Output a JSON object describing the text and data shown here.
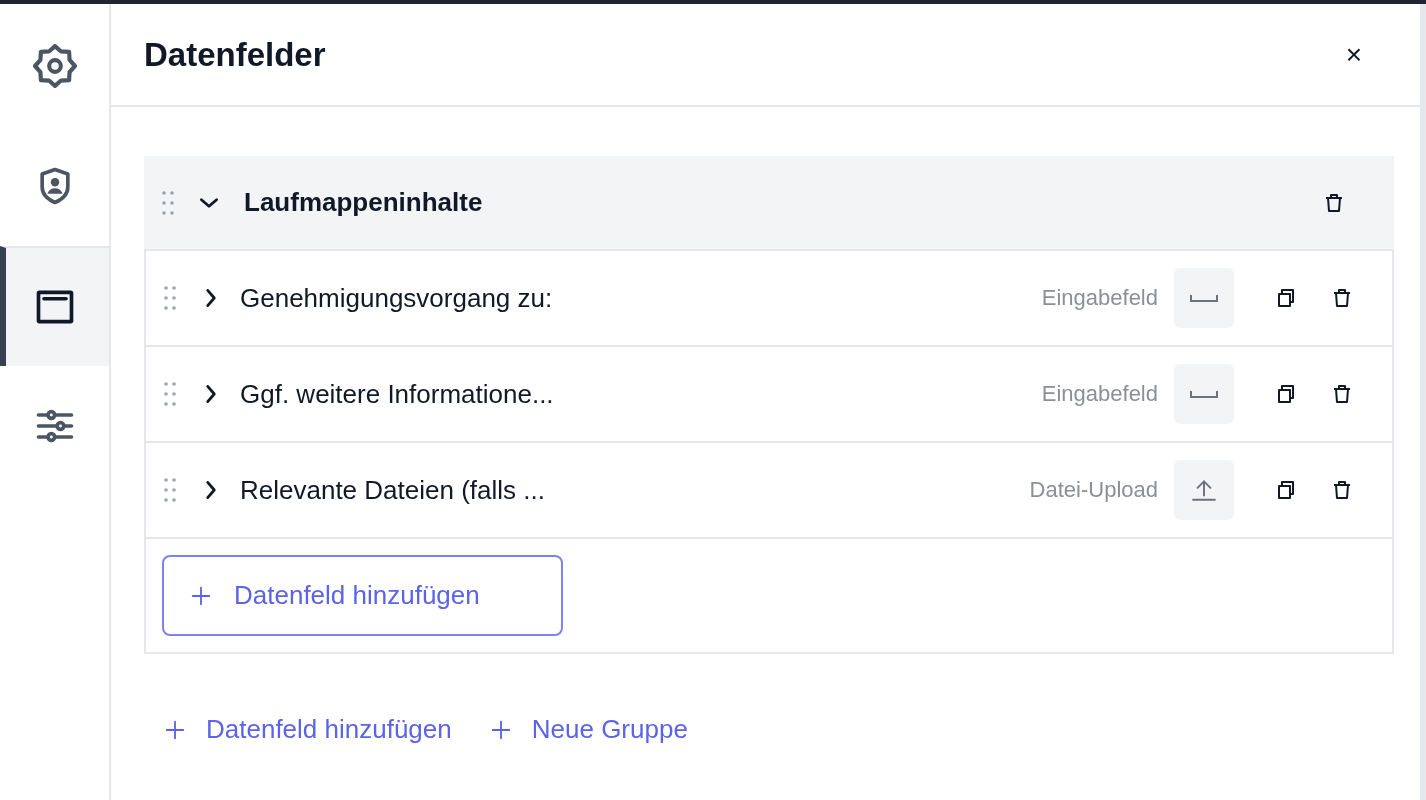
{
  "sidebar": {
    "items": [
      {
        "kind": "settings",
        "selected": false
      },
      {
        "kind": "shield",
        "selected": false
      },
      {
        "kind": "window",
        "selected": true
      },
      {
        "kind": "sliders",
        "selected": false
      }
    ]
  },
  "panel": {
    "title": "Datenfelder",
    "close": "×"
  },
  "group": {
    "title": "Laufmappeninhalte",
    "expanded": true,
    "fields": [
      {
        "label": "Genehmigungsvorgang zu:",
        "type_label": "Eingabefeld",
        "kind": "input",
        "expanded": false
      },
      {
        "label": "Ggf. weitere Informatione...",
        "type_label": "Eingabefeld",
        "kind": "input",
        "expanded": false
      },
      {
        "label": "Relevante Dateien (falls ...",
        "type_label": "Datei-Upload",
        "kind": "upload",
        "expanded": false
      }
    ],
    "add_button": "Datenfeld hinzufügen"
  },
  "footer_actions": [
    {
      "label": "Datenfeld hinzufügen"
    },
    {
      "label": "Neue Gruppe"
    }
  ]
}
